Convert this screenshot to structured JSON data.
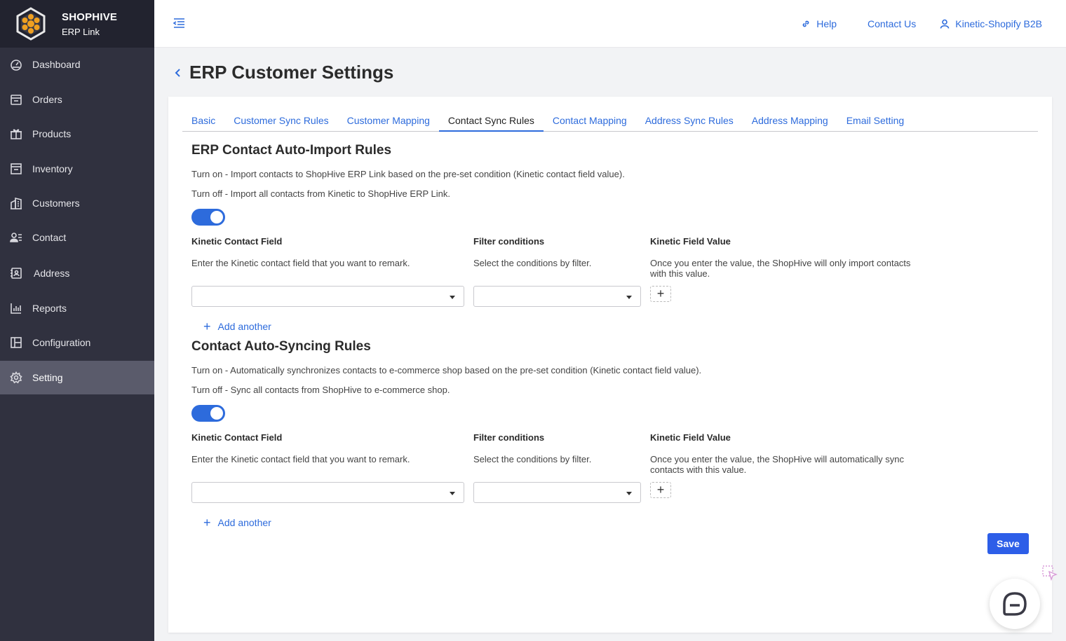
{
  "brand": {
    "name": "SHOPHIVE",
    "subtitle": "ERP Link"
  },
  "sidebar": {
    "items": [
      {
        "label": "Dashboard",
        "icon": "dashboard-icon",
        "active": false
      },
      {
        "label": "Orders",
        "icon": "orders-icon",
        "active": false
      },
      {
        "label": "Products",
        "icon": "gift-icon",
        "active": false
      },
      {
        "label": "Inventory",
        "icon": "inventory-icon",
        "active": false
      },
      {
        "label": "Customers",
        "icon": "building-icon",
        "active": false
      },
      {
        "label": "Contact",
        "icon": "contact-icon",
        "active": false
      },
      {
        "label": "Address",
        "icon": "address-book-icon",
        "active": false
      },
      {
        "label": "Reports",
        "icon": "bar-chart-icon",
        "active": false
      },
      {
        "label": "Configuration",
        "icon": "configuration-icon",
        "active": false
      },
      {
        "label": "Setting",
        "icon": "gear-icon",
        "active": true
      }
    ]
  },
  "topbar": {
    "help": "Help",
    "contact_us": "Contact Us",
    "account": "Kinetic-Shopify B2B"
  },
  "page": {
    "title": "ERP Customer Settings"
  },
  "tabs": [
    {
      "label": "Basic",
      "active": false
    },
    {
      "label": "Customer Sync Rules",
      "active": false
    },
    {
      "label": "Customer Mapping",
      "active": false
    },
    {
      "label": "Contact Sync Rules",
      "active": true
    },
    {
      "label": "Contact Mapping",
      "active": false
    },
    {
      "label": "Address Sync Rules",
      "active": false
    },
    {
      "label": "Address Mapping",
      "active": false
    },
    {
      "label": "Email Setting",
      "active": false
    }
  ],
  "import_rules": {
    "title": "ERP Contact Auto-Import Rules",
    "turn_on": "Turn on - Import contacts to ShopHive ERP Link based on the pre-set condition (Kinetic contact field value).",
    "turn_off": "Turn off - Import all contacts from Kinetic to ShopHive ERP Link.",
    "enabled": true,
    "field_label": "Kinetic Contact Field",
    "field_help": "Enter the Kinetic contact field that you want to remark.",
    "filter_label": "Filter conditions",
    "filter_help": "Select the conditions by filter.",
    "value_label": "Kinetic Field Value",
    "value_help_1": "Once you enter the value, the ShopHive will only import contacts",
    "value_help_2": "with this value.",
    "add_another": "Add another"
  },
  "sync_rules": {
    "title": "Contact Auto-Syncing Rules",
    "turn_on": "Turn on - Automatically synchronizes contacts to e-commerce shop based on the pre-set condition (Kinetic contact field value).",
    "turn_off": "Turn off - Sync all contacts from ShopHive to e-commerce shop.",
    "enabled": true,
    "field_label": "Kinetic Contact Field",
    "field_help": "Enter the Kinetic contact field that you want to remark.",
    "filter_label": "Filter conditions",
    "filter_help": "Select the conditions by filter.",
    "value_label": "Kinetic Field Value",
    "value_help_1": "Once you enter the value, the ShopHive will automatically sync",
    "value_help_2": "contacts with this value.",
    "add_another": "Add another"
  },
  "actions": {
    "save": "Save"
  },
  "colors": {
    "accent": "#2d6bdc",
    "save": "#2d5ee8",
    "sidebar": "#30313f",
    "sidebar_active": "#5a5b6b"
  }
}
